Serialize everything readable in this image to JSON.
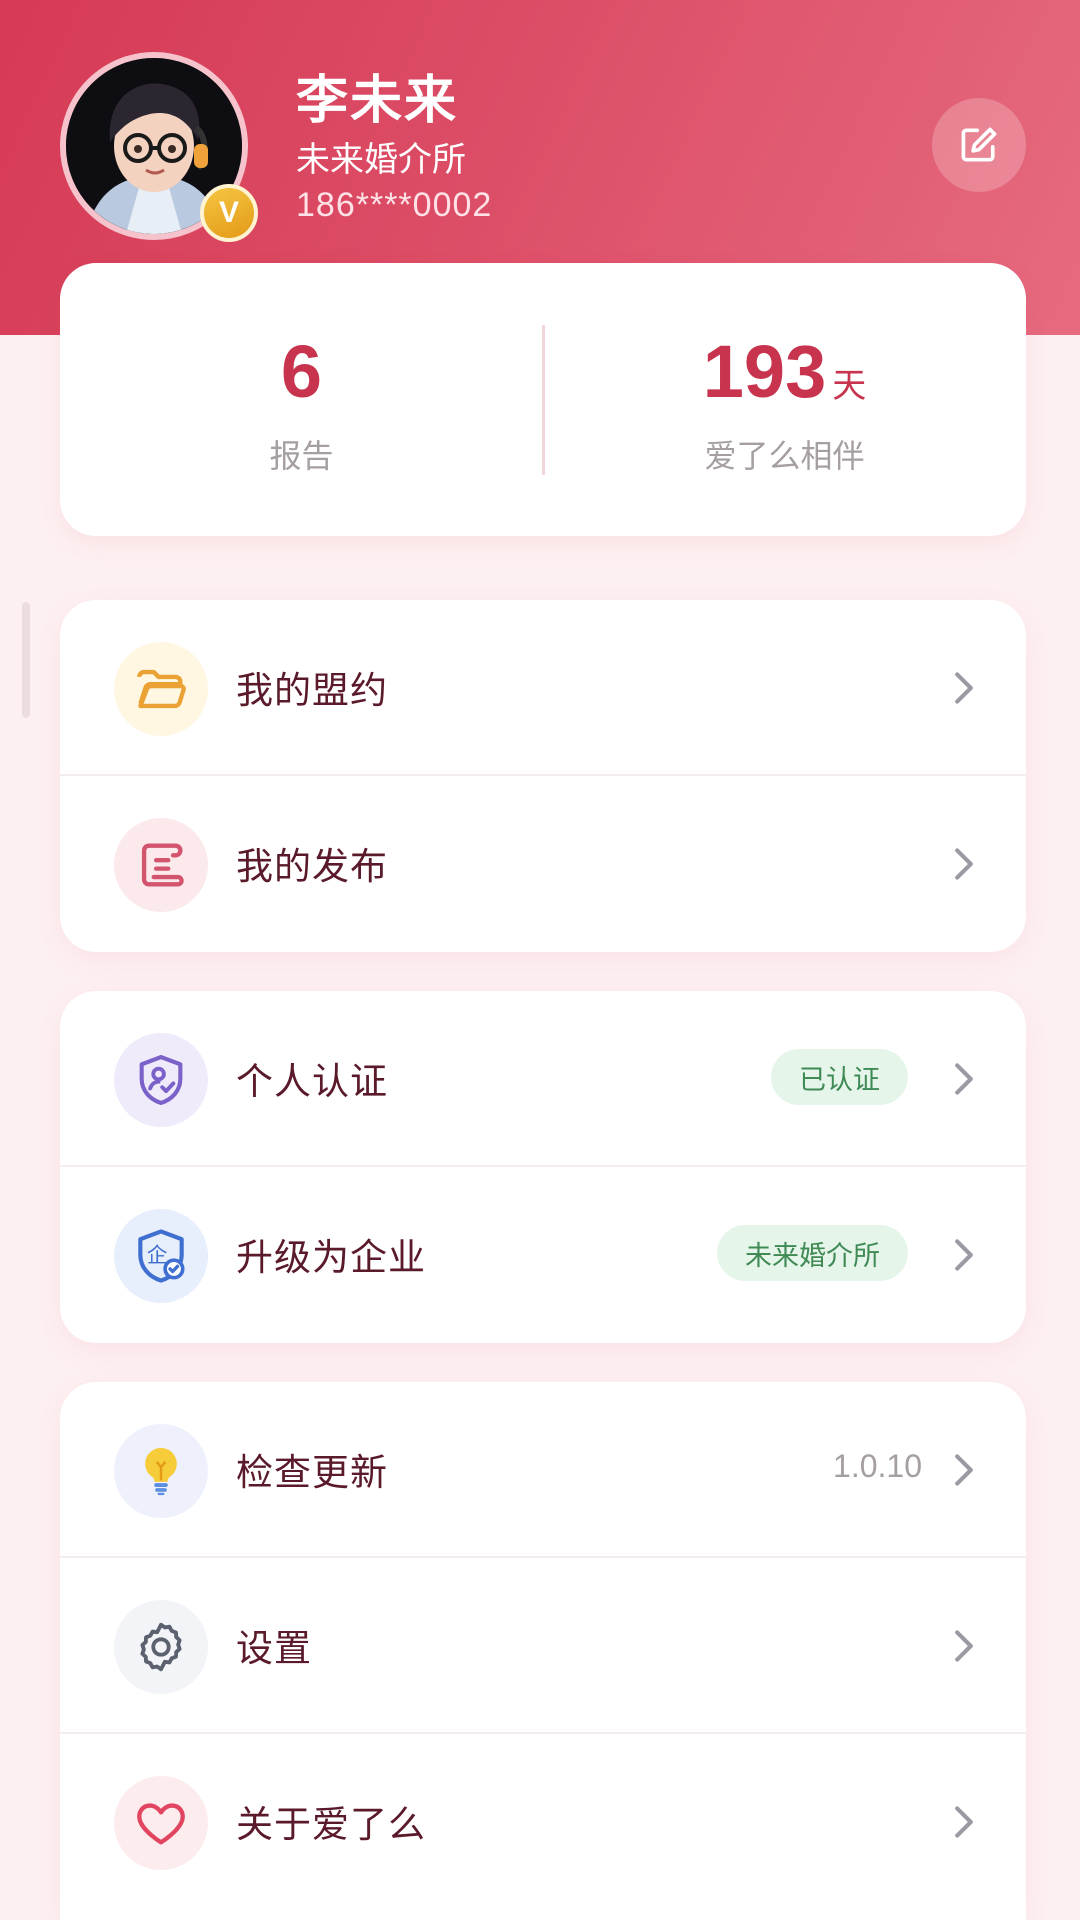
{
  "profile": {
    "name": "李未来",
    "org": "未来婚介所",
    "phone": "186****0002",
    "badge": "V"
  },
  "stats": {
    "reports_value": "6",
    "reports_label": "报告",
    "days_value": "193",
    "days_unit": "天",
    "days_label": "爱了么相伴"
  },
  "menu": {
    "group1": [
      {
        "label": "我的盟约",
        "icon": "folder-icon"
      },
      {
        "label": "我的发布",
        "icon": "scroll-icon"
      }
    ],
    "group2": [
      {
        "label": "个人认证",
        "icon": "shield-user-icon",
        "tag": "已认证"
      },
      {
        "label": "升级为企业",
        "icon": "shield-enterprise-icon",
        "tag": "未来婚介所",
        "tag_icon_char": "企"
      }
    ],
    "group3": [
      {
        "label": "检查更新",
        "icon": "lightbulb-icon",
        "value": "1.0.10"
      },
      {
        "label": "设置",
        "icon": "gear-icon"
      },
      {
        "label": "关于爱了么",
        "icon": "heart-icon"
      }
    ]
  },
  "colors": {
    "brand": "#d63a55",
    "accent_text": "#c8344e",
    "tag_bg": "#e6f5ea",
    "tag_text": "#3f8a55"
  }
}
